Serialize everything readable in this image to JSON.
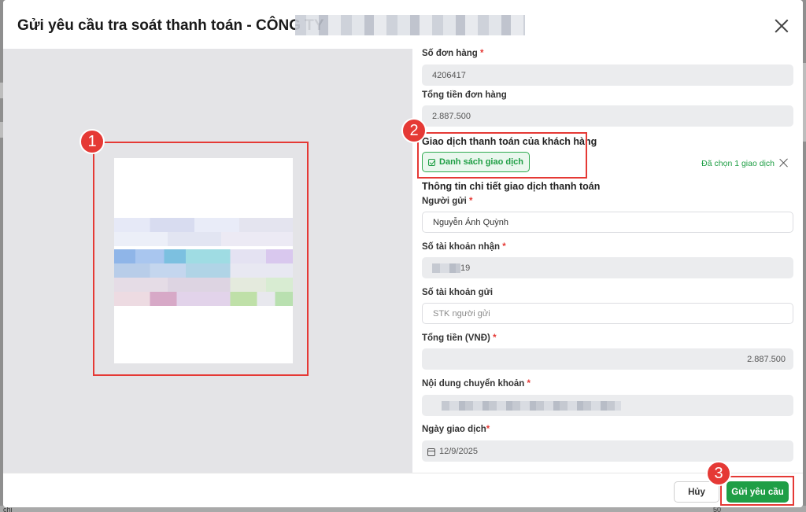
{
  "modal": {
    "title": "Gửi yêu cầu tra soát thanh toán - CÔNG TY",
    "close_icon": "close-icon"
  },
  "markers": [
    "1",
    "2",
    "3"
  ],
  "form": {
    "order_no_label": "Số đơn hàng",
    "order_no_value": "4206417",
    "order_total_label": "Tổng tiền đơn hàng",
    "order_total_value": "2.887.500",
    "customer_txn_label": "Giao dịch thanh toán của khách hàng",
    "txn_list_button": "Danh sách giao dịch",
    "txn_chosen_text": "Đã chọn 1 giao dịch",
    "detail_section_title": "Thông tin chi tiết giao dịch thanh toán",
    "sender_label": "Người gửi",
    "sender_value": "Nguyễn Ánh Quỳnh",
    "recv_account_label": "Số tài khoản nhận",
    "recv_account_value": "19",
    "send_account_label": "Số tài khoản gửi",
    "send_account_placeholder": "STK người gửi",
    "total_vnd_label": "Tổng tiền (VNĐ)",
    "total_vnd_value": "2.887.500",
    "transfer_content_label": "Nội dung chuyển khoản",
    "txn_date_label": "Ngày giao dịch",
    "txn_date_value": "12/9/2025",
    "required_mark": "*"
  },
  "footer": {
    "cancel_label": "Hủy",
    "submit_label": "Gửi yêu cầu"
  },
  "background_hint": {
    "bottom_left": "chi",
    "bottom_right": "50"
  },
  "colors": {
    "accent_green": "#1f9e46",
    "annotation_red": "#e53935"
  }
}
